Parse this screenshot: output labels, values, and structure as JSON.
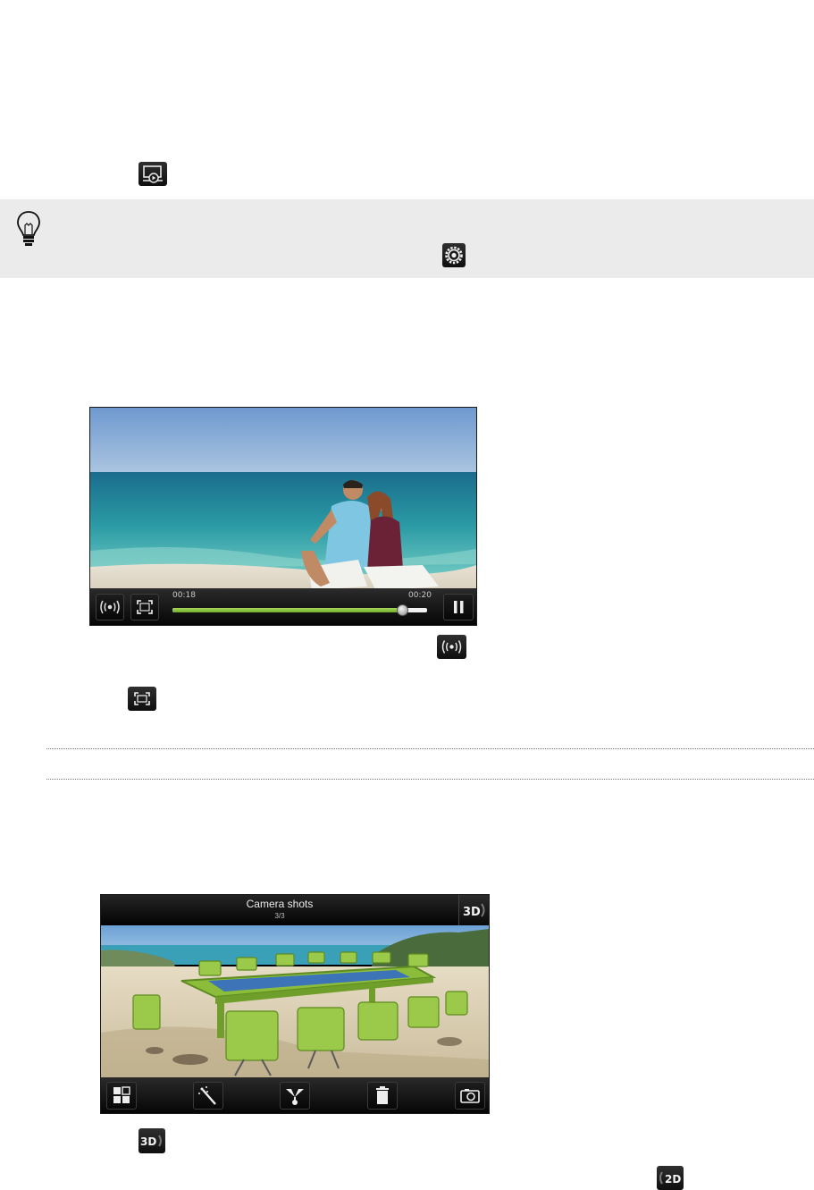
{
  "doc": {
    "icons": {
      "play_on_screen": "slideshow-play-icon",
      "tip": "lightbulb-icon",
      "settings": "settings-gear-icon",
      "broadcast": "broadcast-icon",
      "fullscreen": "fullscreen-icon",
      "mode_3d": "3d-mode-icon",
      "mode_2d": "2d-mode-icon"
    },
    "colors": {
      "tip_background": "#ebebeb",
      "progress_green": "#8cc63f"
    }
  },
  "video_player": {
    "elapsed": "00:18",
    "duration": "00:20",
    "progress": 0.9,
    "controls": [
      "broadcast-icon",
      "fullscreen-icon",
      "pause-icon"
    ]
  },
  "gallery": {
    "title": "Camera shots",
    "counter": "3/3",
    "mode_badge": "3D",
    "toolbar": [
      "grid-view-icon",
      "magic-wand-icon",
      "share-icon",
      "trash-icon",
      "camera-icon"
    ]
  },
  "badges": {
    "mode_3d": "3D",
    "mode_2d": "2D"
  }
}
